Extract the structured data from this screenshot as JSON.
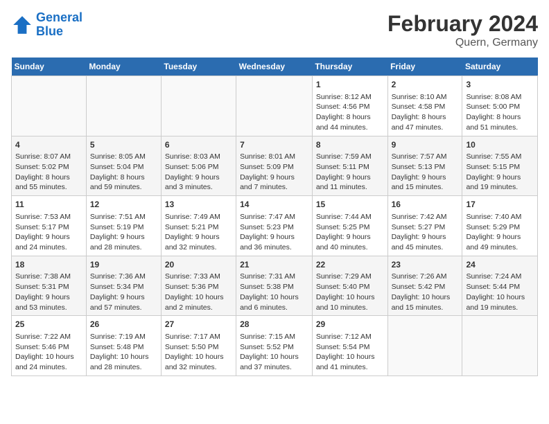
{
  "header": {
    "logo_line1": "General",
    "logo_line2": "Blue",
    "title": "February 2024",
    "subtitle": "Quern, Germany"
  },
  "days_of_week": [
    "Sunday",
    "Monday",
    "Tuesday",
    "Wednesday",
    "Thursday",
    "Friday",
    "Saturday"
  ],
  "weeks": [
    [
      {
        "day": "",
        "content": ""
      },
      {
        "day": "",
        "content": ""
      },
      {
        "day": "",
        "content": ""
      },
      {
        "day": "",
        "content": ""
      },
      {
        "day": "1",
        "content": "Sunrise: 8:12 AM\nSunset: 4:56 PM\nDaylight: 8 hours\nand 44 minutes."
      },
      {
        "day": "2",
        "content": "Sunrise: 8:10 AM\nSunset: 4:58 PM\nDaylight: 8 hours\nand 47 minutes."
      },
      {
        "day": "3",
        "content": "Sunrise: 8:08 AM\nSunset: 5:00 PM\nDaylight: 8 hours\nand 51 minutes."
      }
    ],
    [
      {
        "day": "4",
        "content": "Sunrise: 8:07 AM\nSunset: 5:02 PM\nDaylight: 8 hours\nand 55 minutes."
      },
      {
        "day": "5",
        "content": "Sunrise: 8:05 AM\nSunset: 5:04 PM\nDaylight: 8 hours\nand 59 minutes."
      },
      {
        "day": "6",
        "content": "Sunrise: 8:03 AM\nSunset: 5:06 PM\nDaylight: 9 hours\nand 3 minutes."
      },
      {
        "day": "7",
        "content": "Sunrise: 8:01 AM\nSunset: 5:09 PM\nDaylight: 9 hours\nand 7 minutes."
      },
      {
        "day": "8",
        "content": "Sunrise: 7:59 AM\nSunset: 5:11 PM\nDaylight: 9 hours\nand 11 minutes."
      },
      {
        "day": "9",
        "content": "Sunrise: 7:57 AM\nSunset: 5:13 PM\nDaylight: 9 hours\nand 15 minutes."
      },
      {
        "day": "10",
        "content": "Sunrise: 7:55 AM\nSunset: 5:15 PM\nDaylight: 9 hours\nand 19 minutes."
      }
    ],
    [
      {
        "day": "11",
        "content": "Sunrise: 7:53 AM\nSunset: 5:17 PM\nDaylight: 9 hours\nand 24 minutes."
      },
      {
        "day": "12",
        "content": "Sunrise: 7:51 AM\nSunset: 5:19 PM\nDaylight: 9 hours\nand 28 minutes."
      },
      {
        "day": "13",
        "content": "Sunrise: 7:49 AM\nSunset: 5:21 PM\nDaylight: 9 hours\nand 32 minutes."
      },
      {
        "day": "14",
        "content": "Sunrise: 7:47 AM\nSunset: 5:23 PM\nDaylight: 9 hours\nand 36 minutes."
      },
      {
        "day": "15",
        "content": "Sunrise: 7:44 AM\nSunset: 5:25 PM\nDaylight: 9 hours\nand 40 minutes."
      },
      {
        "day": "16",
        "content": "Sunrise: 7:42 AM\nSunset: 5:27 PM\nDaylight: 9 hours\nand 45 minutes."
      },
      {
        "day": "17",
        "content": "Sunrise: 7:40 AM\nSunset: 5:29 PM\nDaylight: 9 hours\nand 49 minutes."
      }
    ],
    [
      {
        "day": "18",
        "content": "Sunrise: 7:38 AM\nSunset: 5:31 PM\nDaylight: 9 hours\nand 53 minutes."
      },
      {
        "day": "19",
        "content": "Sunrise: 7:36 AM\nSunset: 5:34 PM\nDaylight: 9 hours\nand 57 minutes."
      },
      {
        "day": "20",
        "content": "Sunrise: 7:33 AM\nSunset: 5:36 PM\nDaylight: 10 hours\nand 2 minutes."
      },
      {
        "day": "21",
        "content": "Sunrise: 7:31 AM\nSunset: 5:38 PM\nDaylight: 10 hours\nand 6 minutes."
      },
      {
        "day": "22",
        "content": "Sunrise: 7:29 AM\nSunset: 5:40 PM\nDaylight: 10 hours\nand 10 minutes."
      },
      {
        "day": "23",
        "content": "Sunrise: 7:26 AM\nSunset: 5:42 PM\nDaylight: 10 hours\nand 15 minutes."
      },
      {
        "day": "24",
        "content": "Sunrise: 7:24 AM\nSunset: 5:44 PM\nDaylight: 10 hours\nand 19 minutes."
      }
    ],
    [
      {
        "day": "25",
        "content": "Sunrise: 7:22 AM\nSunset: 5:46 PM\nDaylight: 10 hours\nand 24 minutes."
      },
      {
        "day": "26",
        "content": "Sunrise: 7:19 AM\nSunset: 5:48 PM\nDaylight: 10 hours\nand 28 minutes."
      },
      {
        "day": "27",
        "content": "Sunrise: 7:17 AM\nSunset: 5:50 PM\nDaylight: 10 hours\nand 32 minutes."
      },
      {
        "day": "28",
        "content": "Sunrise: 7:15 AM\nSunset: 5:52 PM\nDaylight: 10 hours\nand 37 minutes."
      },
      {
        "day": "29",
        "content": "Sunrise: 7:12 AM\nSunset: 5:54 PM\nDaylight: 10 hours\nand 41 minutes."
      },
      {
        "day": "",
        "content": ""
      },
      {
        "day": "",
        "content": ""
      }
    ]
  ]
}
